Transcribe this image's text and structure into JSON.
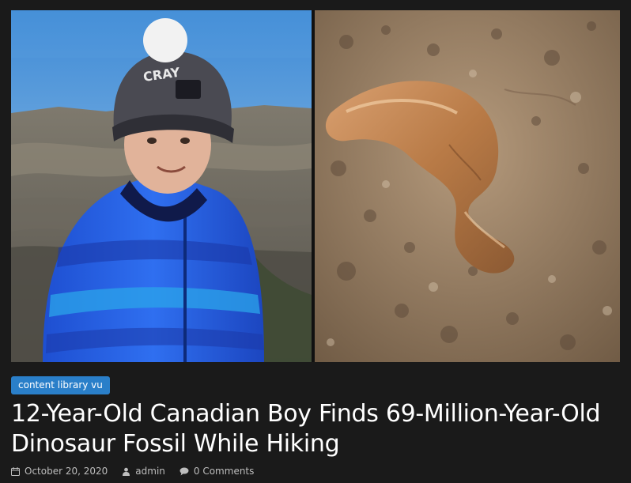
{
  "article": {
    "category": "content library vu",
    "title": "12-Year-Old Canadian Boy Finds 69-Million-Year-Old Dinosaur Fossil While Hiking",
    "date": "October 20, 2020",
    "author": "admin",
    "comments": "0 Comments"
  },
  "hero": {
    "left_icon": "photo-boy-in-badlands",
    "right_icon": "photo-dinosaur-fossil",
    "beanie_text": "CRAY"
  },
  "colors": {
    "background": "#1a1a1a",
    "badge": "#2a7fc9",
    "title": "#ffffff",
    "meta": "#bdbdbd"
  }
}
